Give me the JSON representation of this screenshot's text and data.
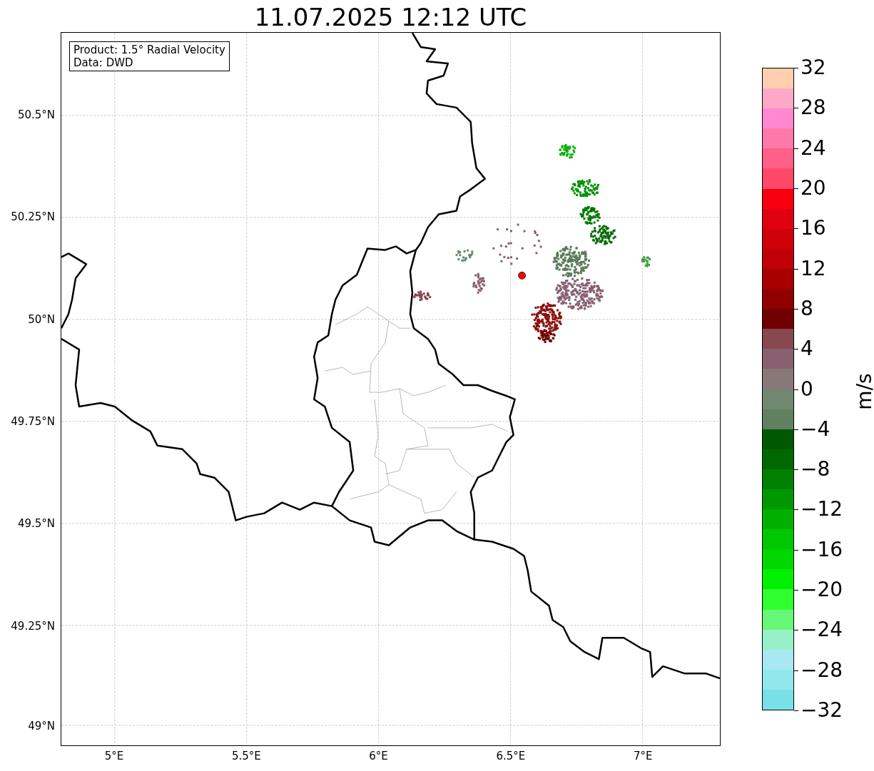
{
  "title": "11.07.2025 12:12 UTC",
  "map": {
    "info_box": [
      "Product: 1.5° Radial Velocity",
      "Data: DWD"
    ],
    "yticks": [
      "50.5°N",
      "50.25°N",
      "50°N",
      "49.75°N",
      "49.5°N",
      "49.25°N",
      "49°N"
    ],
    "xticks": [
      "5°E",
      "5.5°E",
      "6°E",
      "6.5°E",
      "7°E"
    ]
  },
  "colorbar": {
    "label": "m/s",
    "ticks": [
      "32",
      "28",
      "24",
      "20",
      "16",
      "12",
      "8",
      "4",
      "0",
      "−4",
      "−8",
      "−12",
      "−16",
      "−20",
      "−24",
      "−28",
      "−32"
    ],
    "bands": [
      {
        "color": "#ffcfb0"
      },
      {
        "color": "#ffa8c8"
      },
      {
        "color": "#ff88d0"
      },
      {
        "color": "#ff78a8"
      },
      {
        "color": "#ff6088"
      },
      {
        "color": "#ff4868"
      },
      {
        "color": "#f80010"
      },
      {
        "color": "#e00010"
      },
      {
        "color": "#d00008"
      },
      {
        "color": "#c00008"
      },
      {
        "color": "#a80000"
      },
      {
        "color": "#900000"
      },
      {
        "color": "#700000"
      },
      {
        "color": "#884850"
      },
      {
        "color": "#886070"
      },
      {
        "color": "#887878"
      },
      {
        "color": "#708870"
      },
      {
        "color": "#608060"
      },
      {
        "color": "#005800"
      },
      {
        "color": "#006800"
      },
      {
        "color": "#008000"
      },
      {
        "color": "#009800"
      },
      {
        "color": "#00b000"
      },
      {
        "color": "#00c800"
      },
      {
        "color": "#00d800"
      },
      {
        "color": "#00f000"
      },
      {
        "color": "#30ff30"
      },
      {
        "color": "#68f878"
      },
      {
        "color": "#98f0c8"
      },
      {
        "color": "#a8e8f0"
      },
      {
        "color": "#90e8ec"
      },
      {
        "color": "#78e0e8"
      }
    ]
  }
}
